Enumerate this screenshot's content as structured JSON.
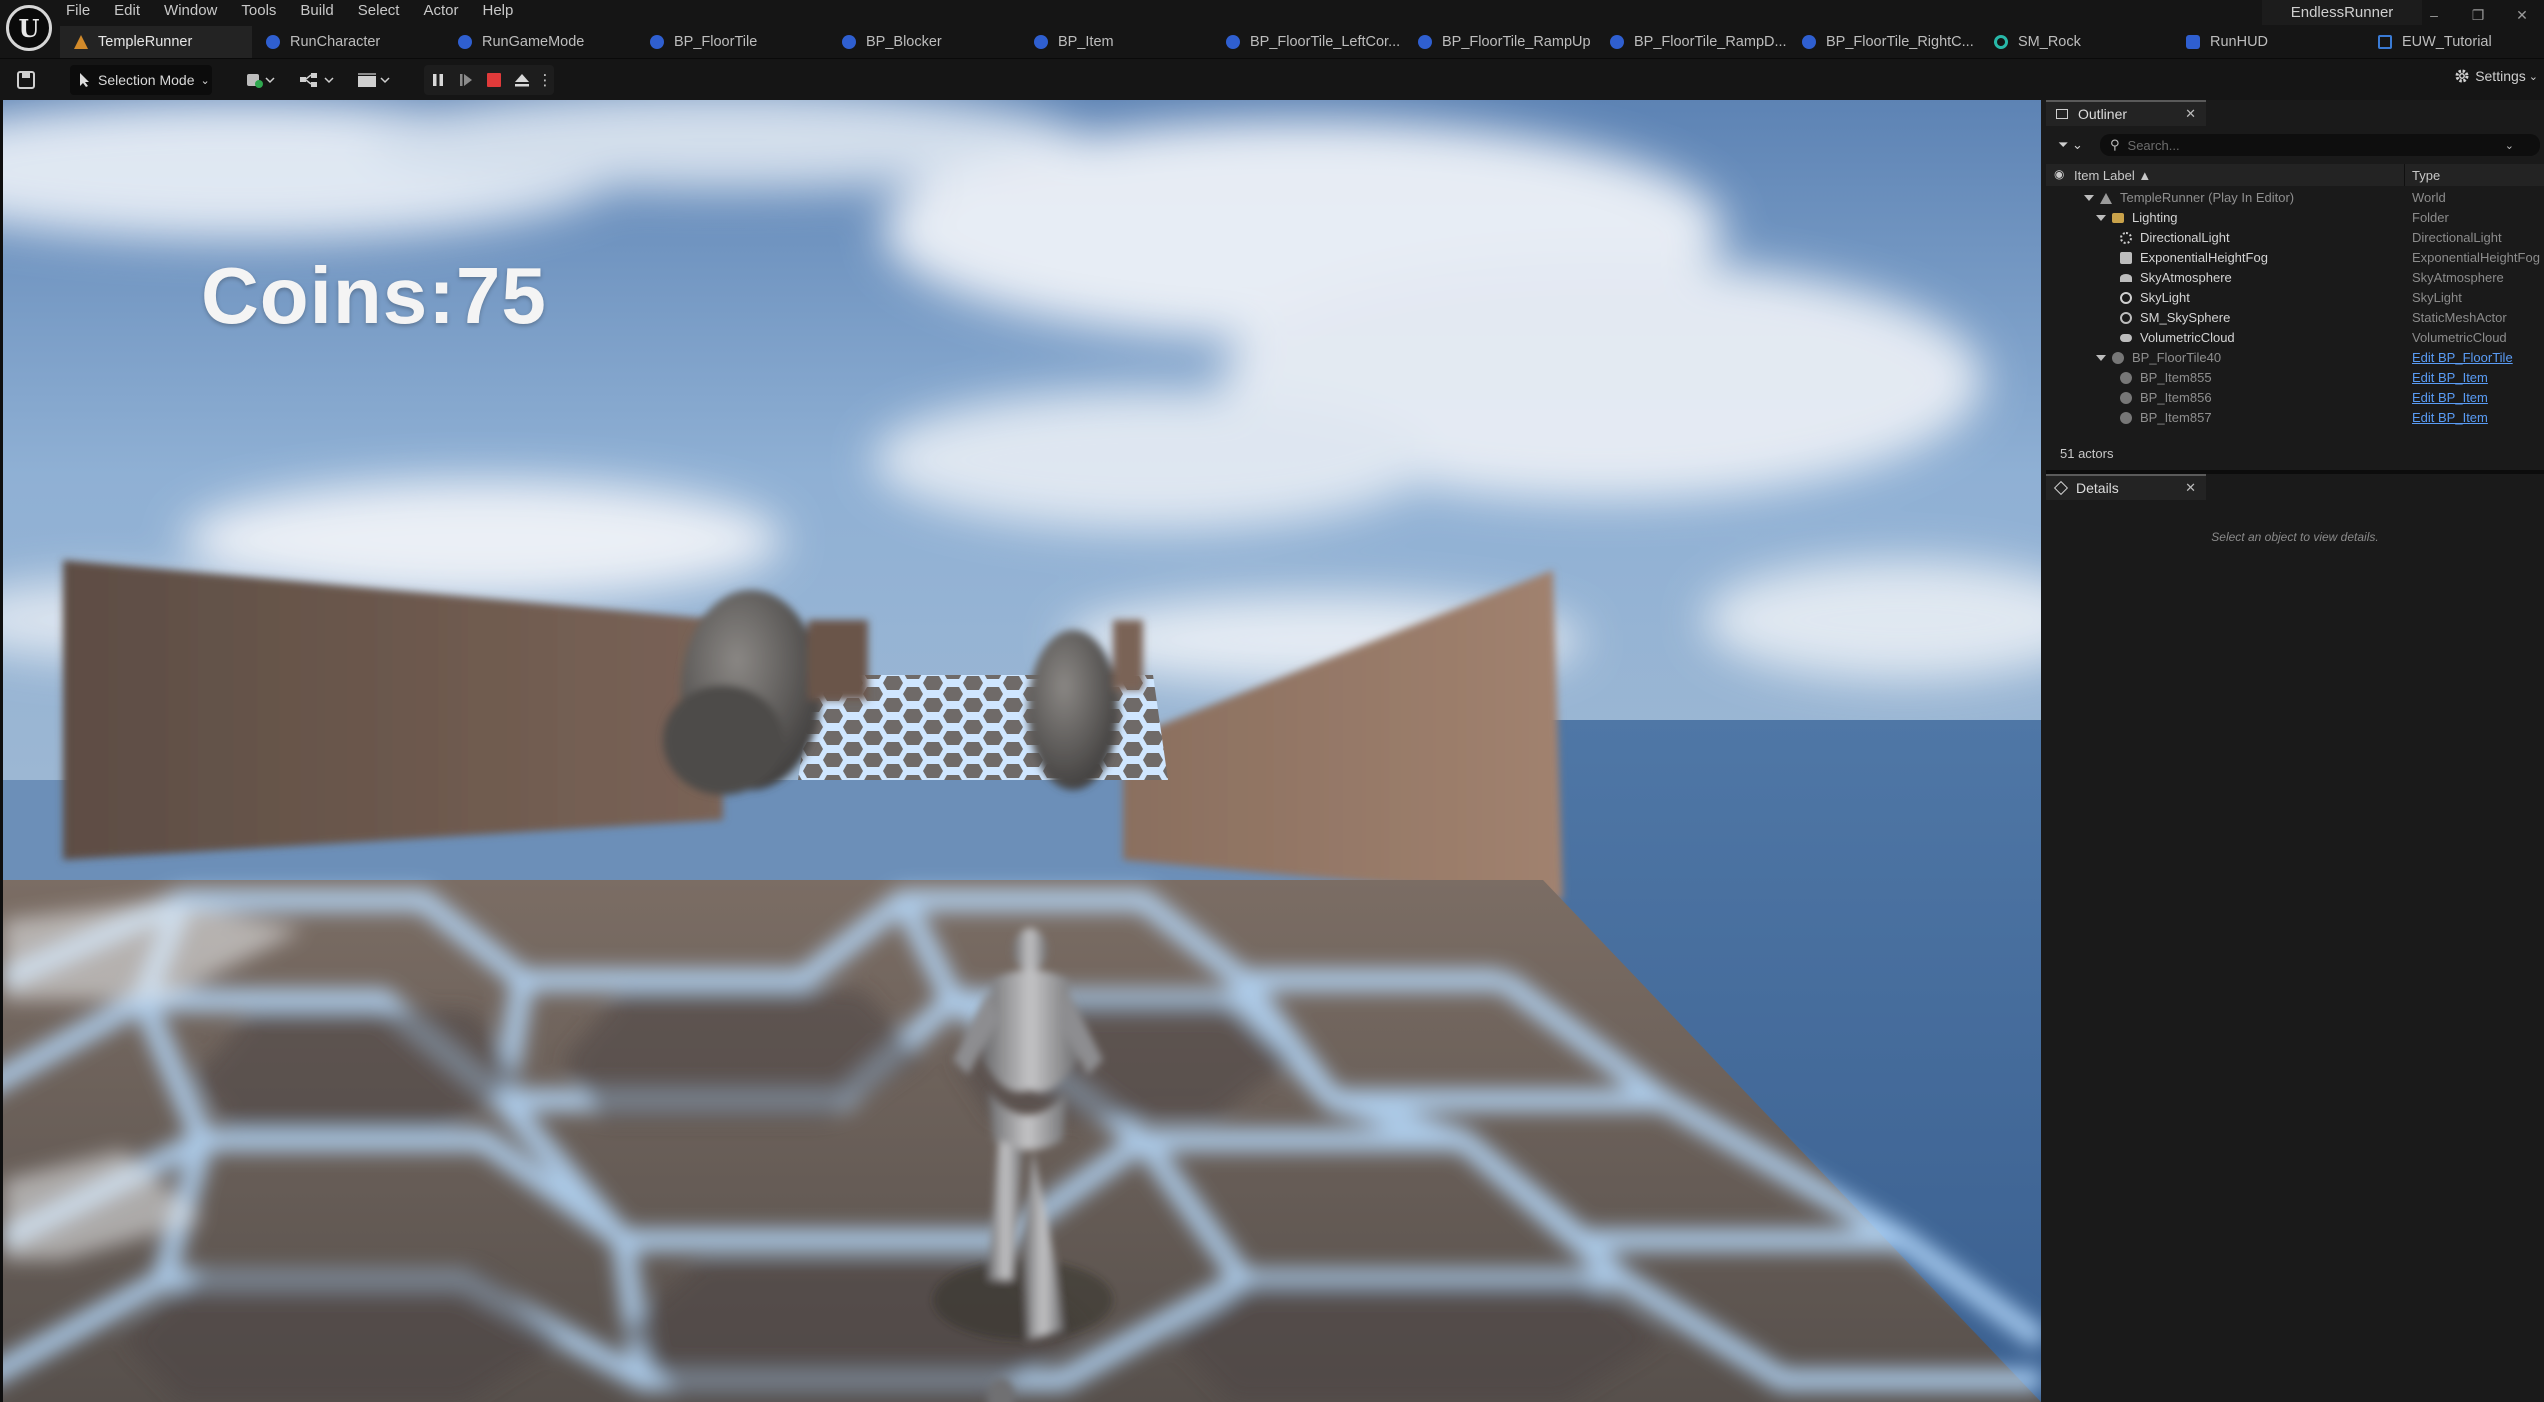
{
  "menu": [
    "File",
    "Edit",
    "Window",
    "Tools",
    "Build",
    "Select",
    "Actor",
    "Help"
  ],
  "project_name": "EndlessRunner",
  "window_controls": [
    "–",
    "❐",
    "✕"
  ],
  "tabs": [
    {
      "label": "TempleRunner",
      "icon": "level-icon",
      "active": true
    },
    {
      "label": "RunCharacter",
      "icon": "blueprint-icon"
    },
    {
      "label": "RunGameMode",
      "icon": "blueprint-icon"
    },
    {
      "label": "BP_FloorTile",
      "icon": "blueprint-icon"
    },
    {
      "label": "BP_Blocker",
      "icon": "blueprint-icon"
    },
    {
      "label": "BP_Item",
      "icon": "blueprint-icon"
    },
    {
      "label": "BP_FloorTile_LeftCor...",
      "icon": "blueprint-icon"
    },
    {
      "label": "BP_FloorTile_RampUp",
      "icon": "blueprint-icon"
    },
    {
      "label": "BP_FloorTile_RampD...",
      "icon": "blueprint-icon"
    },
    {
      "label": "BP_FloorTile_RightC...",
      "icon": "blueprint-icon"
    },
    {
      "label": "SM_Rock",
      "icon": "static-mesh-icon"
    },
    {
      "label": "RunHUD",
      "icon": "hud-icon"
    },
    {
      "label": "EUW_Tutorial",
      "icon": "editor-widget-icon"
    }
  ],
  "toolbar": {
    "selection_mode": "Selection Mode",
    "settings": "Settings"
  },
  "hud": {
    "coins_text": "Coins:75"
  },
  "outliner": {
    "tab_label": "Outliner",
    "search_placeholder": "Search...",
    "col_label": "Item Label ▲",
    "col_type": "Type",
    "rows": [
      {
        "label": "TempleRunner (Play In Editor)",
        "type": "World",
        "icon": "world-icon",
        "dim": true
      },
      {
        "label": "Lighting",
        "type": "Folder",
        "icon": "folder-icon"
      },
      {
        "label": "DirectionalLight",
        "type": "DirectionalLight",
        "icon": "directional-light-icon"
      },
      {
        "label": "ExponentialHeightFog",
        "type": "ExponentialHeightFog",
        "icon": "fog-icon"
      },
      {
        "label": "SkyAtmosphere",
        "type": "SkyAtmosphere",
        "icon": "sky-atmosphere-icon"
      },
      {
        "label": "SkyLight",
        "type": "SkyLight",
        "icon": "skylight-icon"
      },
      {
        "label": "SM_SkySphere",
        "type": "StaticMeshActor",
        "icon": "static-mesh-icon"
      },
      {
        "label": "VolumetricCloud",
        "type": "VolumetricCloud",
        "icon": "cloud-icon"
      },
      {
        "label": "BP_FloorTile40",
        "type": "Edit BP_FloorTile",
        "icon": "actor-icon",
        "dim": true,
        "link": true
      },
      {
        "label": "BP_Item855",
        "type": "Edit BP_Item",
        "icon": "actor-icon",
        "dim": true,
        "link": true
      },
      {
        "label": "BP_Item856",
        "type": "Edit BP_Item",
        "icon": "actor-icon",
        "dim": true,
        "link": true
      },
      {
        "label": "BP_Item857",
        "type": "Edit BP_Item",
        "icon": "actor-icon",
        "dim": true,
        "link": true
      }
    ],
    "actor_count": "51 actors"
  },
  "details": {
    "tab_label": "Details",
    "hint": "Select an object to view details."
  },
  "colors": {
    "accent_blue": "#5a9cf5",
    "stop_red": "#e03a3a",
    "panel_bg": "#1a1a1a",
    "topbar_bg": "#151515"
  }
}
